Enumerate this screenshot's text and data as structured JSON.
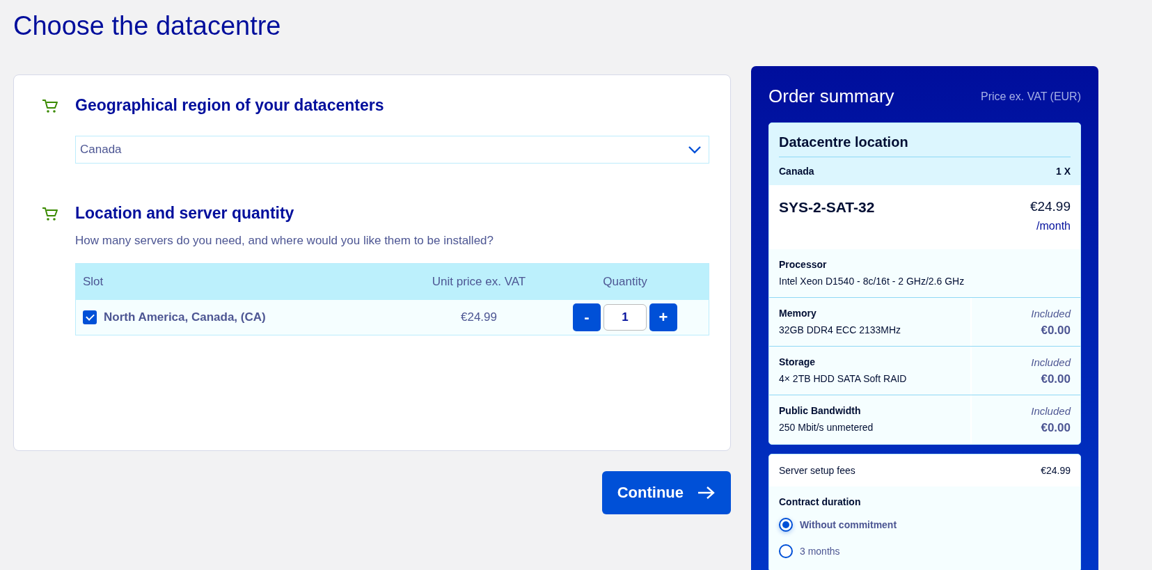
{
  "page_title": "Choose the datacentre",
  "sections": [
    {
      "title": "Geographical region of your datacenters",
      "kind": "select",
      "select": {
        "value": "Canada"
      }
    },
    {
      "title": "Location and server quantity",
      "kind": "table",
      "description": "How many servers do you need, and where would you like them to be installed?",
      "table": {
        "columns": [
          "Slot",
          "Unit price ex. VAT",
          "Quantity"
        ],
        "rows": [
          {
            "slot": "North America, Canada, (CA)",
            "checked": true,
            "price": "€24.99",
            "decrement": "-",
            "quantity": "1",
            "increment": "+"
          }
        ]
      }
    }
  ],
  "continue_button": "Continue",
  "summary": {
    "title": "Order summary",
    "price_note": "Price ex. VAT (EUR)",
    "location": {
      "title": "Datacentre location",
      "name": "Canada",
      "count": "1 X"
    },
    "product": {
      "name": "SYS-2-SAT-32",
      "price": "€24.99",
      "period": "/month"
    },
    "components": [
      {
        "label": "Processor",
        "value": "Intel Xeon D1540 - 8c/16t - 2 GHz/2.6 GHz"
      },
      {
        "label": "Memory",
        "value": "32GB DDR4 ECC 2133MHz",
        "note": "Included",
        "price": "€0.00"
      },
      {
        "label": "Storage",
        "value": "4× 2TB HDD SATA Soft RAID",
        "note": "Included",
        "price": "€0.00"
      },
      {
        "label": "Public Bandwidth",
        "value": "250 Mbit/s unmetered",
        "note": "Included",
        "price": "€0.00"
      }
    ],
    "setup_fees": {
      "label": "Server setup fees",
      "price": "€24.99"
    },
    "contract": {
      "title": "Contract duration",
      "options": [
        {
          "label": "Without commitment",
          "selected": true
        },
        {
          "label": "3 months",
          "selected": false
        }
      ]
    }
  }
}
